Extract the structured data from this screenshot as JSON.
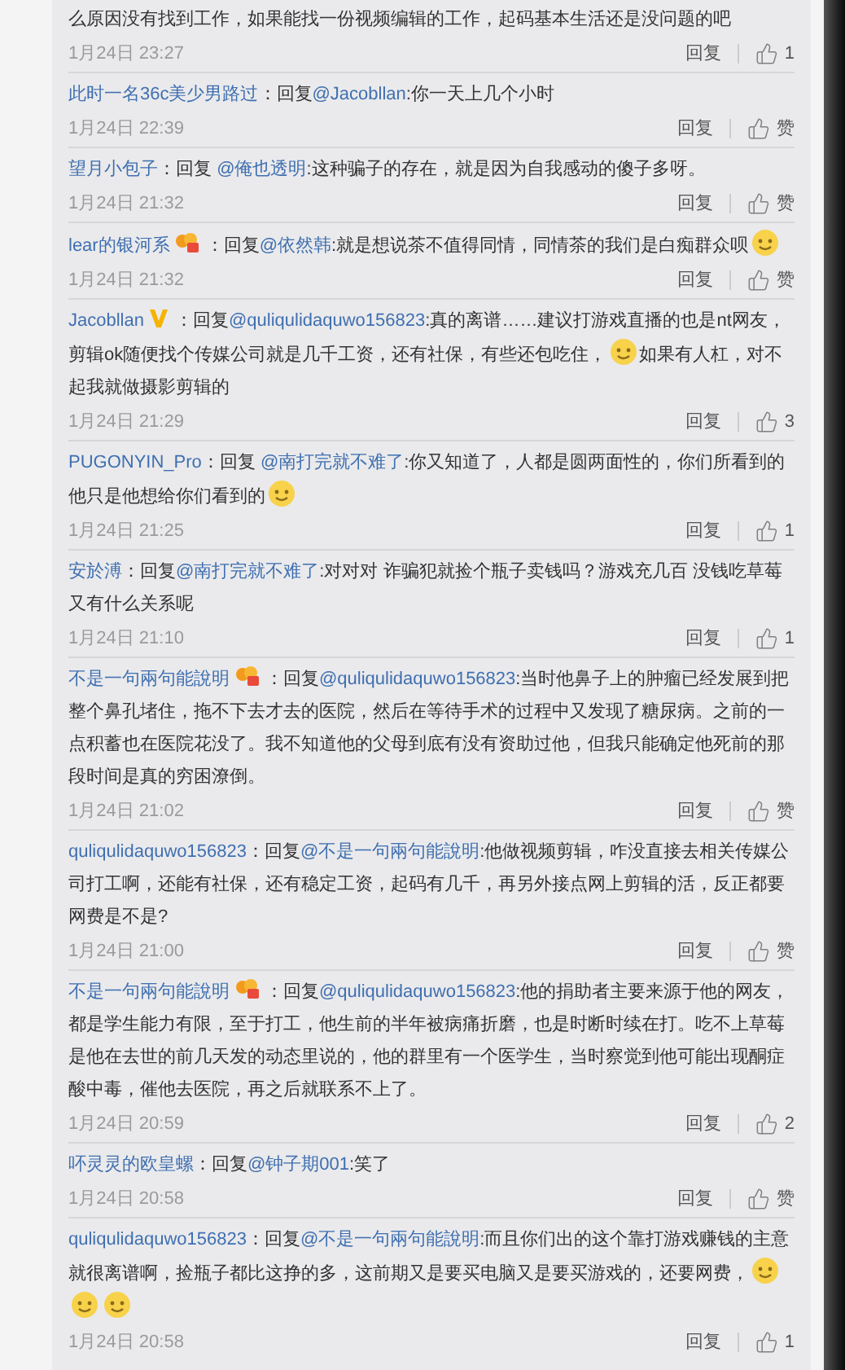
{
  "comments": [
    {
      "content": [
        {
          "kind": "text",
          "text": "么原因没有找到工作，如果能找一份视频编辑的工作，起码基本生活还是没问题的吧"
        }
      ],
      "date": "1月24日 23:27",
      "reply": "回复",
      "likes": "1"
    },
    {
      "user": "此时一名36c美少男路过",
      "content": [
        {
          "kind": "text",
          "text": "：回复"
        },
        {
          "kind": "mention",
          "text": "@Jacobllan"
        },
        {
          "kind": "text",
          "text": ":你一天上几个小时"
        }
      ],
      "date": "1月24日 22:39",
      "reply": "回复",
      "likes": "赞"
    },
    {
      "user": "望月小包子",
      "content": [
        {
          "kind": "text",
          "text": "：回复 "
        },
        {
          "kind": "mention",
          "text": "@俺也透明"
        },
        {
          "kind": "text",
          "text": ":这种骗子的存在，就是因为自我感动的傻子多呀。"
        }
      ],
      "date": "1月24日 21:32",
      "reply": "回复",
      "likes": "赞"
    },
    {
      "user": "lear的银河系",
      "badge": {
        "kind": "fan"
      },
      "content": [
        {
          "kind": "text",
          "text": "：回复"
        },
        {
          "kind": "mention",
          "text": "@依然韩"
        },
        {
          "kind": "text",
          "text": ":就是想说茶不值得同情，同情茶的我们是白痴群众呗"
        },
        {
          "kind": "emoji"
        }
      ],
      "date": "1月24日 21:32",
      "reply": "回复",
      "likes": "赞"
    },
    {
      "user": "Jacobllan",
      "badge": {
        "kind": "vip"
      },
      "content": [
        {
          "kind": "text",
          "text": "：回复"
        },
        {
          "kind": "mention",
          "text": "@quliqulidaquwo156823"
        },
        {
          "kind": "text",
          "text": ":真的离谱……建议打游戏直播的也是nt网友，剪辑ok随便找个传媒公司就是几千工资，还有社保，有些还包吃住，"
        },
        {
          "kind": "emoji"
        },
        {
          "kind": "text",
          "text": "如果有人杠，对不起我就做摄影剪辑的"
        }
      ],
      "date": "1月24日 21:29",
      "reply": "回复",
      "likes": "3"
    },
    {
      "user": "PUGONYIN_Pro",
      "content": [
        {
          "kind": "text",
          "text": "：回复 "
        },
        {
          "kind": "mention",
          "text": "@南打完就不难了"
        },
        {
          "kind": "text",
          "text": ":你又知道了，人都是圆两面性的，你们所看到的他只是他想给你们看到的"
        },
        {
          "kind": "emoji"
        }
      ],
      "date": "1月24日 21:25",
      "reply": "回复",
      "likes": "1"
    },
    {
      "user": "安於溥",
      "content": [
        {
          "kind": "text",
          "text": "：回复"
        },
        {
          "kind": "mention",
          "text": "@南打完就不难了"
        },
        {
          "kind": "text",
          "text": ":对对对 诈骗犯就捡个瓶子卖钱吗？游戏充几百 没钱吃草莓又有什么关系呢"
        }
      ],
      "date": "1月24日 21:10",
      "reply": "回复",
      "likes": "1"
    },
    {
      "user": "不是一句兩句能說明",
      "badge": {
        "kind": "fan"
      },
      "content": [
        {
          "kind": "text",
          "text": "：回复"
        },
        {
          "kind": "mention",
          "text": "@quliqulidaquwo156823"
        },
        {
          "kind": "text",
          "text": ":当时他鼻子上的肿瘤已经发展到把整个鼻孔堵住，拖不下去才去的医院，然后在等待手术的过程中又发现了糖尿病。之前的一点积蓄也在医院花没了。我不知道他的父母到底有没有资助过他，但我只能确定他死前的那段时间是真的穷困潦倒。"
        }
      ],
      "date": "1月24日 21:02",
      "reply": "回复",
      "likes": "赞"
    },
    {
      "user": "quliqulidaquwo156823",
      "content": [
        {
          "kind": "text",
          "text": "：回复"
        },
        {
          "kind": "mention",
          "text": "@不是一句兩句能說明"
        },
        {
          "kind": "text",
          "text": ":他做视频剪辑，咋没直接去相关传媒公司打工啊，还能有社保，还有稳定工资，起码有几千，再另外接点网上剪辑的活，反正都要网费是不是?"
        }
      ],
      "date": "1月24日 21:00",
      "reply": "回复",
      "likes": "赞"
    },
    {
      "user": "不是一句兩句能說明",
      "badge": {
        "kind": "fan"
      },
      "content": [
        {
          "kind": "text",
          "text": "：回复"
        },
        {
          "kind": "mention",
          "text": "@quliqulidaquwo156823"
        },
        {
          "kind": "text",
          "text": ":他的捐助者主要来源于他的网友，都是学生能力有限，至于打工，他生前的半年被病痛折磨，也是时断时续在打。吃不上草莓是他在去世的前几天发的动态里说的，他的群里有一个医学生，当时察觉到他可能出现酮症酸中毒，催他去医院，再之后就联系不上了。"
        }
      ],
      "date": "1月24日 20:59",
      "reply": "回复",
      "likes": "2"
    },
    {
      "user": "吥灵灵的欧皇螺",
      "content": [
        {
          "kind": "text",
          "text": "：回复"
        },
        {
          "kind": "mention",
          "text": "@钟子期001"
        },
        {
          "kind": "text",
          "text": ":笑了"
        }
      ],
      "date": "1月24日 20:58",
      "reply": "回复",
      "likes": "赞"
    },
    {
      "user": "quliqulidaquwo156823",
      "content": [
        {
          "kind": "text",
          "text": "：回复"
        },
        {
          "kind": "mention",
          "text": "@不是一句兩句能說明"
        },
        {
          "kind": "text",
          "text": ":而且你们出的这个靠打游戏赚钱的主意就很离谱啊，捡瓶子都比这挣的多，这前期又是要买电脑又是要买游戏的，还要网费，"
        },
        {
          "kind": "emoji"
        },
        {
          "kind": "emoji"
        },
        {
          "kind": "emoji"
        }
      ],
      "date": "1月24日 20:58",
      "reply": "回复",
      "likes": "1"
    }
  ]
}
